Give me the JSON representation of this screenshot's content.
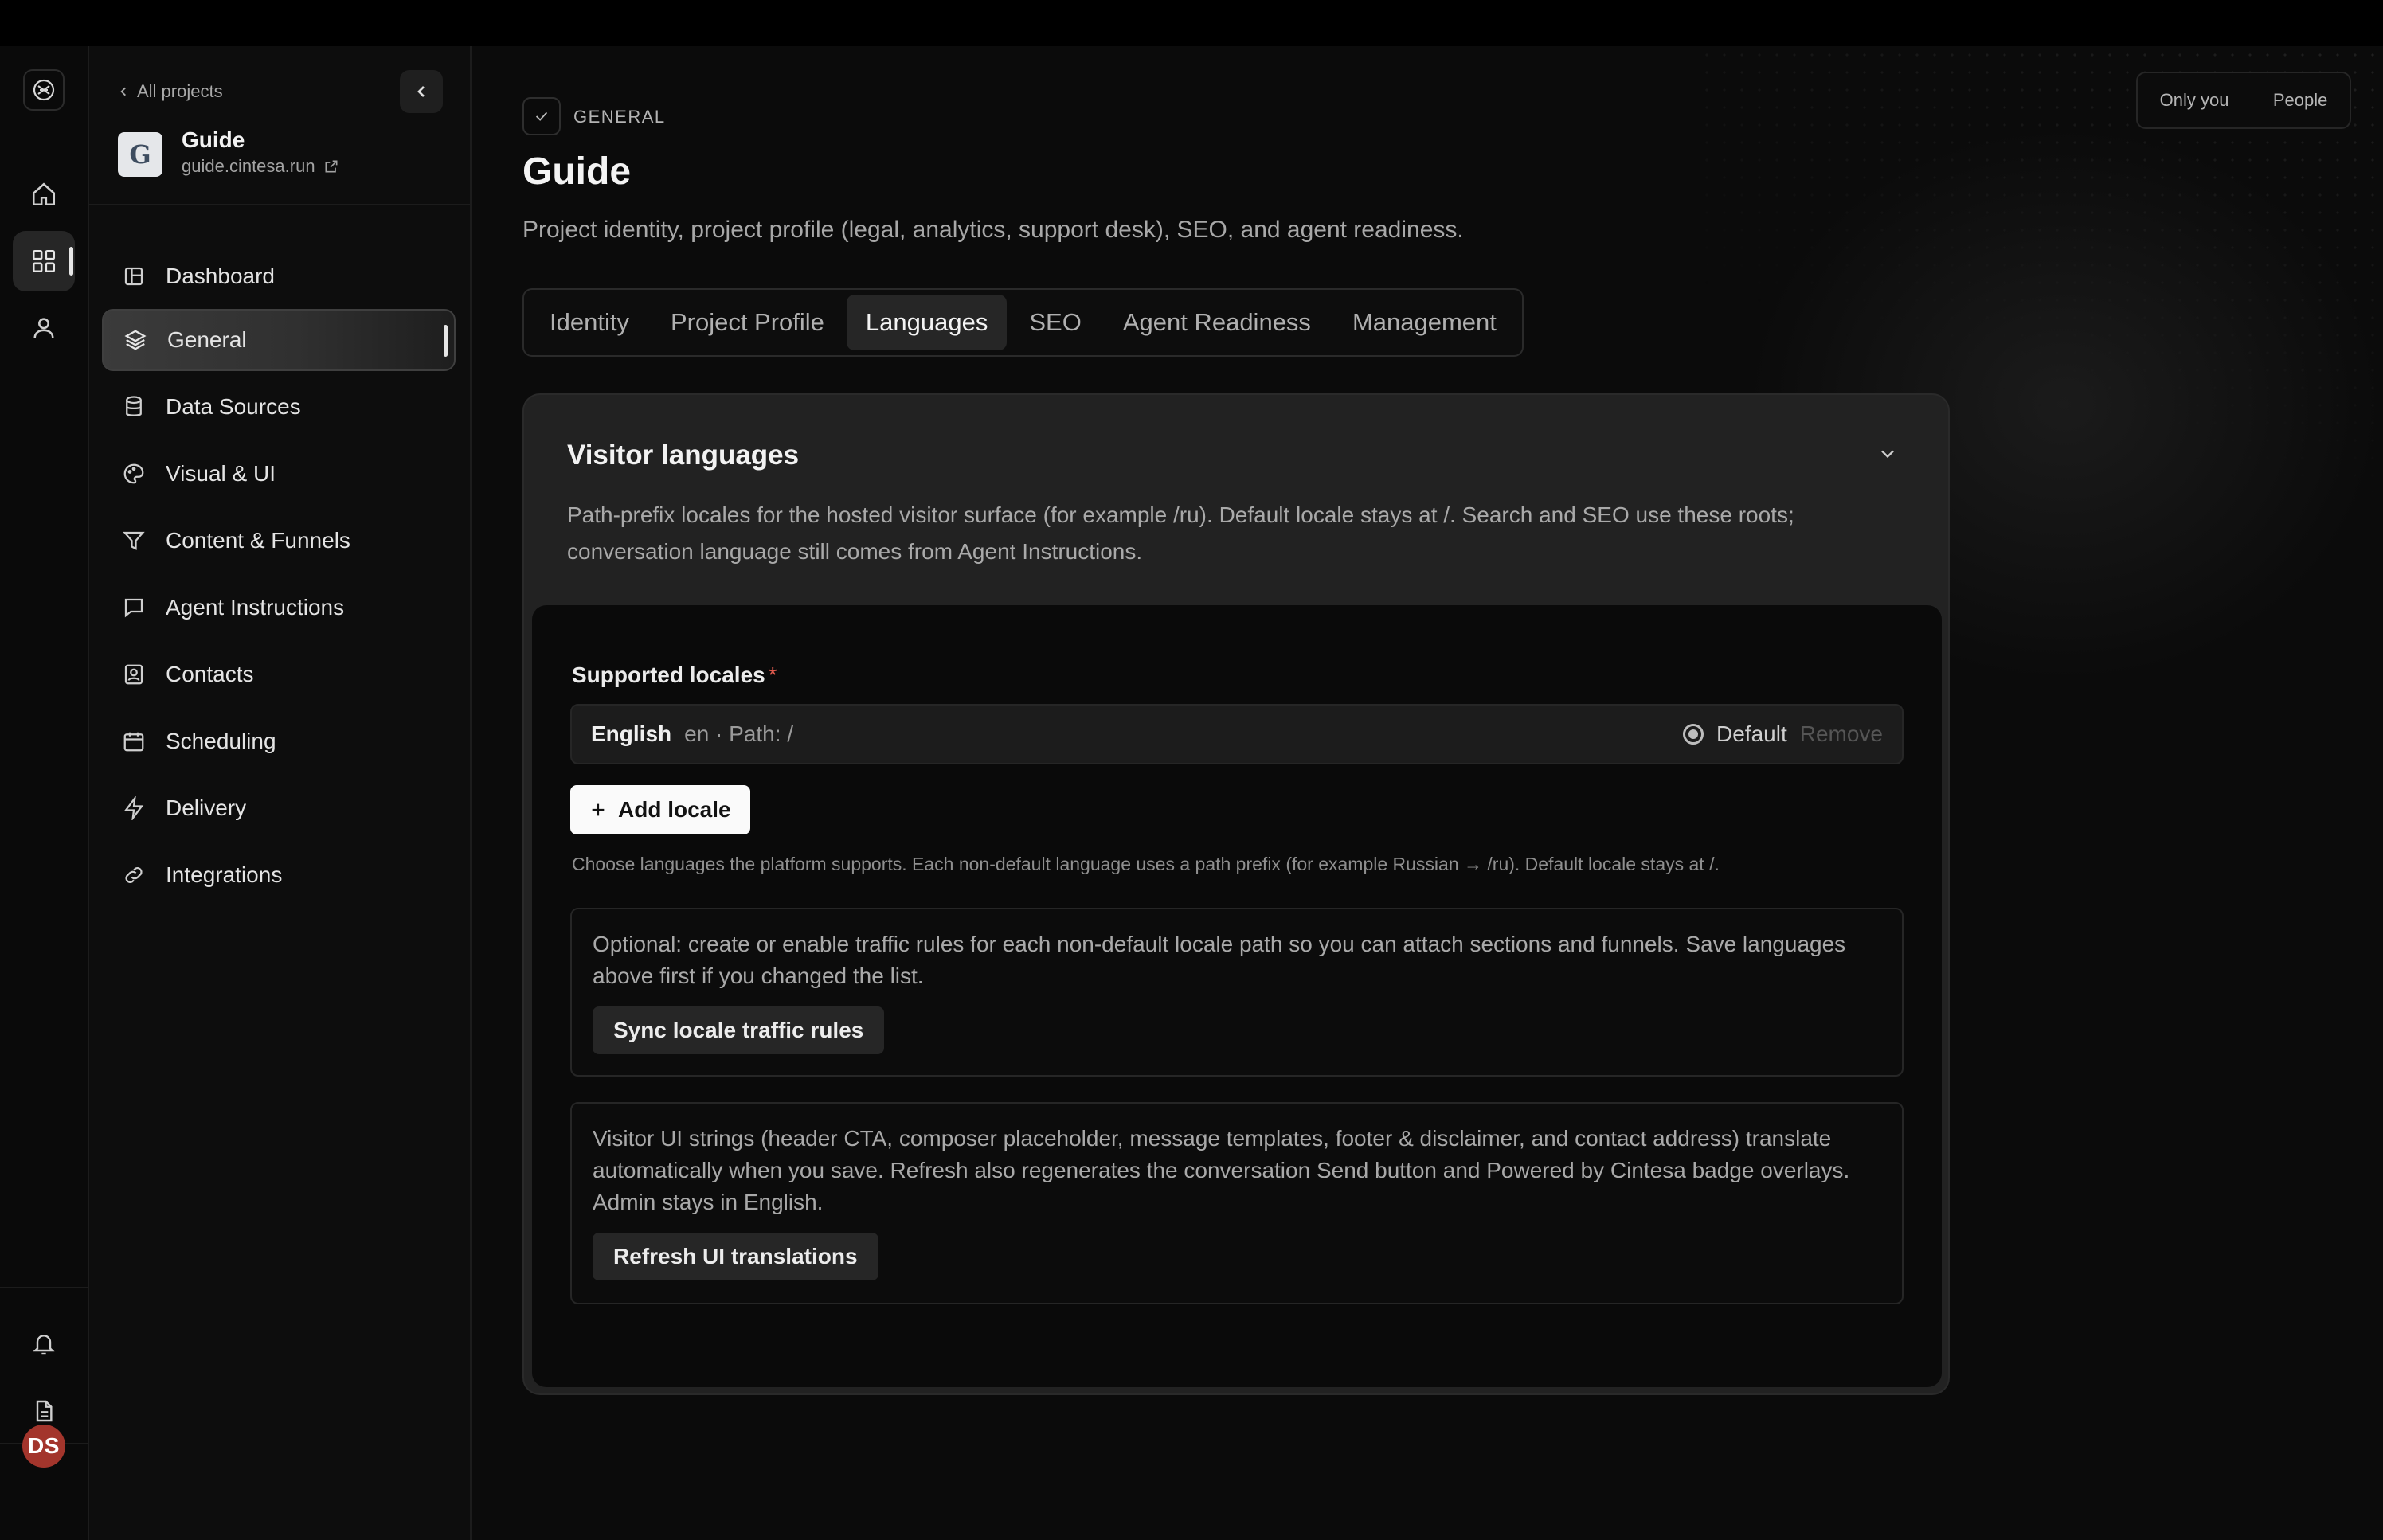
{
  "sidebar": {
    "back_label": "All projects",
    "project_name": "Guide",
    "project_url": "guide.cintesa.run",
    "items": [
      {
        "label": "Dashboard"
      },
      {
        "label": "General"
      },
      {
        "label": "Data Sources"
      },
      {
        "label": "Visual & UI"
      },
      {
        "label": "Content & Funnels"
      },
      {
        "label": "Agent Instructions"
      },
      {
        "label": "Contacts"
      },
      {
        "label": "Scheduling"
      },
      {
        "label": "Delivery"
      },
      {
        "label": "Integrations"
      }
    ]
  },
  "rail": {
    "avatar_initials": "DS"
  },
  "header": {
    "breadcrumb": "GENERAL",
    "title": "Guide",
    "subtitle": "Project identity, project profile (legal, analytics, support desk), SEO, and agent readiness.",
    "visibility": {
      "only_you": "Only you",
      "people": "People"
    }
  },
  "tabs": [
    {
      "label": "Identity"
    },
    {
      "label": "Project Profile"
    },
    {
      "label": "Languages"
    },
    {
      "label": "SEO"
    },
    {
      "label": "Agent Readiness"
    },
    {
      "label": "Management"
    }
  ],
  "languages_card": {
    "title": "Visitor languages",
    "description": "Path-prefix locales for the hosted visitor surface (for example /ru). Default locale stays at /. Search and SEO use these roots; conversation language still comes from Agent Instructions.",
    "supported_label": "Supported locales",
    "required_mark": "*",
    "locales": [
      {
        "name": "English",
        "meta": "en · Path: /",
        "default_label": "Default",
        "remove_label": "Remove"
      }
    ],
    "add_label": "Add locale",
    "help_text": "Choose languages the platform supports. Each non-default language uses a path prefix (for example Russian → /ru). Default locale stays at /.",
    "traffic": {
      "text": "Optional: create or enable traffic rules for each non-default locale path so you can attach sections and funnels. Save languages above first if you changed the list.",
      "button": "Sync locale traffic rules"
    },
    "translations": {
      "text": "Visitor UI strings (header CTA, composer placeholder, message templates, footer & disclaimer, and contact address) translate automatically when you save. Refresh also regenerates the conversation Send button and Powered by Cintesa badge overlays. Admin stays in English.",
      "button": "Refresh UI translations"
    }
  }
}
